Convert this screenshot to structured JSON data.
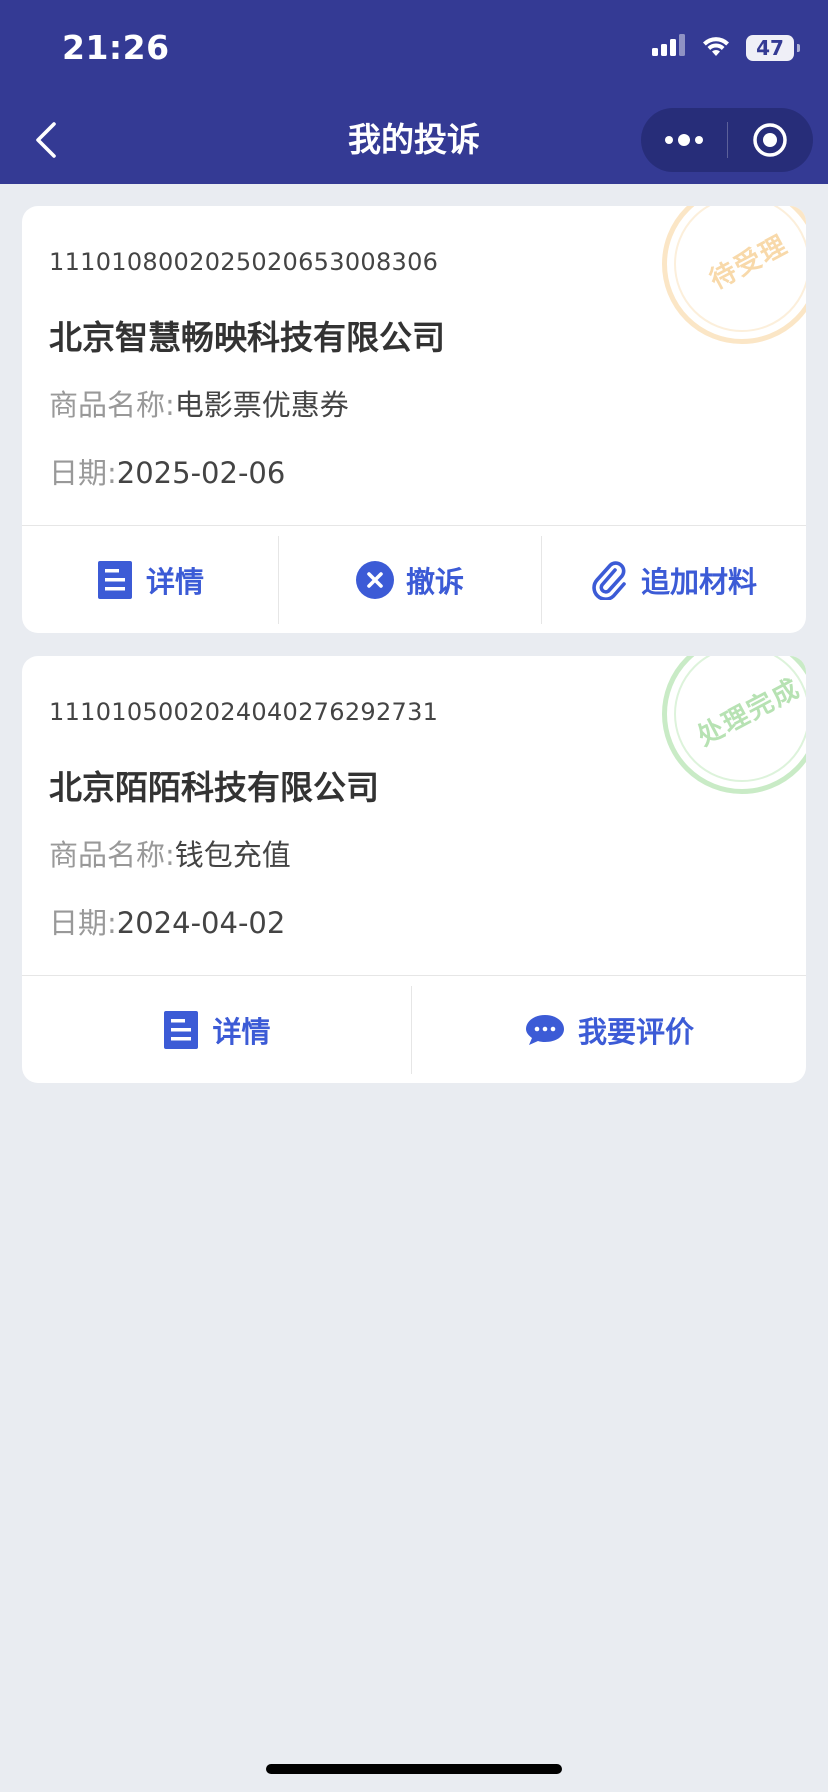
{
  "status_bar": {
    "time": "21:26",
    "battery": "47",
    "icons": [
      "signal-icon",
      "wifi-icon",
      "battery-icon"
    ]
  },
  "nav": {
    "title": "我的投诉",
    "back_icon": "chevron-left-icon",
    "more_icon": "more-dots-icon",
    "close_icon": "record-circle-icon"
  },
  "colors": {
    "header_bg": "#343A94",
    "accent": "#3C5BD6",
    "page_bg": "#E9ECF1",
    "stamp_pending": "#F8D9AA",
    "stamp_done": "#B7E2B3"
  },
  "complaints": [
    {
      "number": "1110108002025020653008306",
      "company": "北京智慧畅映科技有限公司",
      "product_label": "商品名称:",
      "product": "电影票优惠券",
      "date_label": "日期:",
      "date": "2025-02-06",
      "stamp": "待受理",
      "actions": [
        {
          "label": "详情",
          "icon": "document-icon"
        },
        {
          "label": "撤诉",
          "icon": "close-circle-icon"
        },
        {
          "label": "追加材料",
          "icon": "paperclip-icon"
        }
      ]
    },
    {
      "number": "1110105002024040276292731",
      "company": "北京陌陌科技有限公司",
      "product_label": "商品名称:",
      "product": "钱包充值",
      "date_label": "日期:",
      "date": "2024-04-02",
      "stamp": "处理完成",
      "actions": [
        {
          "label": "详情",
          "icon": "document-icon"
        },
        {
          "label": "我要评价",
          "icon": "chat-bubble-icon"
        }
      ]
    }
  ]
}
